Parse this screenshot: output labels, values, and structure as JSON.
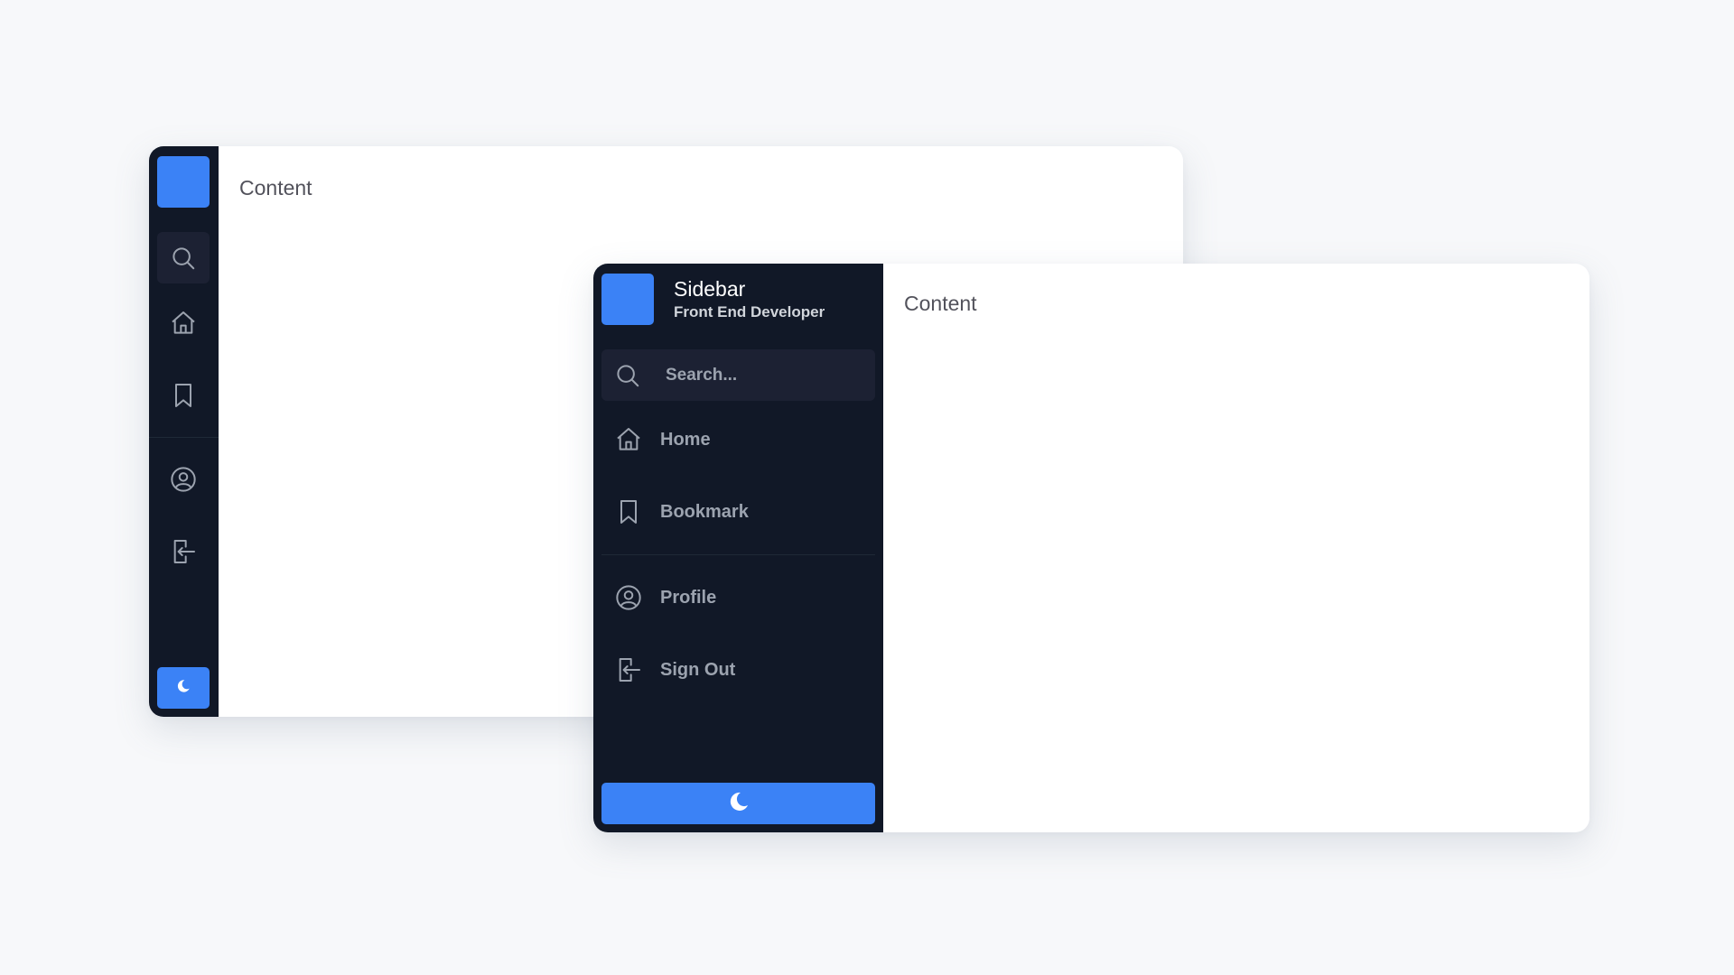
{
  "windows": {
    "collapsed": {
      "search_icon": "search-icon",
      "menu": [
        {
          "id": "home",
          "label": "Home",
          "icon": "home-icon"
        },
        {
          "id": "bookmark",
          "label": "Bookmark",
          "icon": "bookmark-icon"
        },
        {
          "id": "profile",
          "label": "Profile",
          "icon": "user-circle-icon"
        },
        {
          "id": "sign-out",
          "label": "Sign Out",
          "icon": "sign-out-icon"
        }
      ],
      "theme_icon": "moon-icon",
      "content_text": "Content"
    },
    "expanded": {
      "brand_title": "Sidebar",
      "brand_subtitle": "Front End Developer",
      "search_placeholder": "Search...",
      "search_value": "",
      "menu": [
        {
          "id": "home",
          "label": "Home",
          "icon": "home-icon"
        },
        {
          "id": "bookmark",
          "label": "Bookmark",
          "icon": "bookmark-icon"
        },
        {
          "id": "profile",
          "label": "Profile",
          "icon": "user-circle-icon"
        },
        {
          "id": "sign-out",
          "label": "Sign Out",
          "icon": "sign-out-icon"
        }
      ],
      "theme_icon": "moon-icon",
      "content_text": "Content"
    }
  },
  "colors": {
    "accent": "#3b82f6",
    "sidebar_bg": "#111827",
    "search_bg": "#1c2133",
    "muted_text": "#9ca3af",
    "page_bg": "#f7f8fa"
  }
}
